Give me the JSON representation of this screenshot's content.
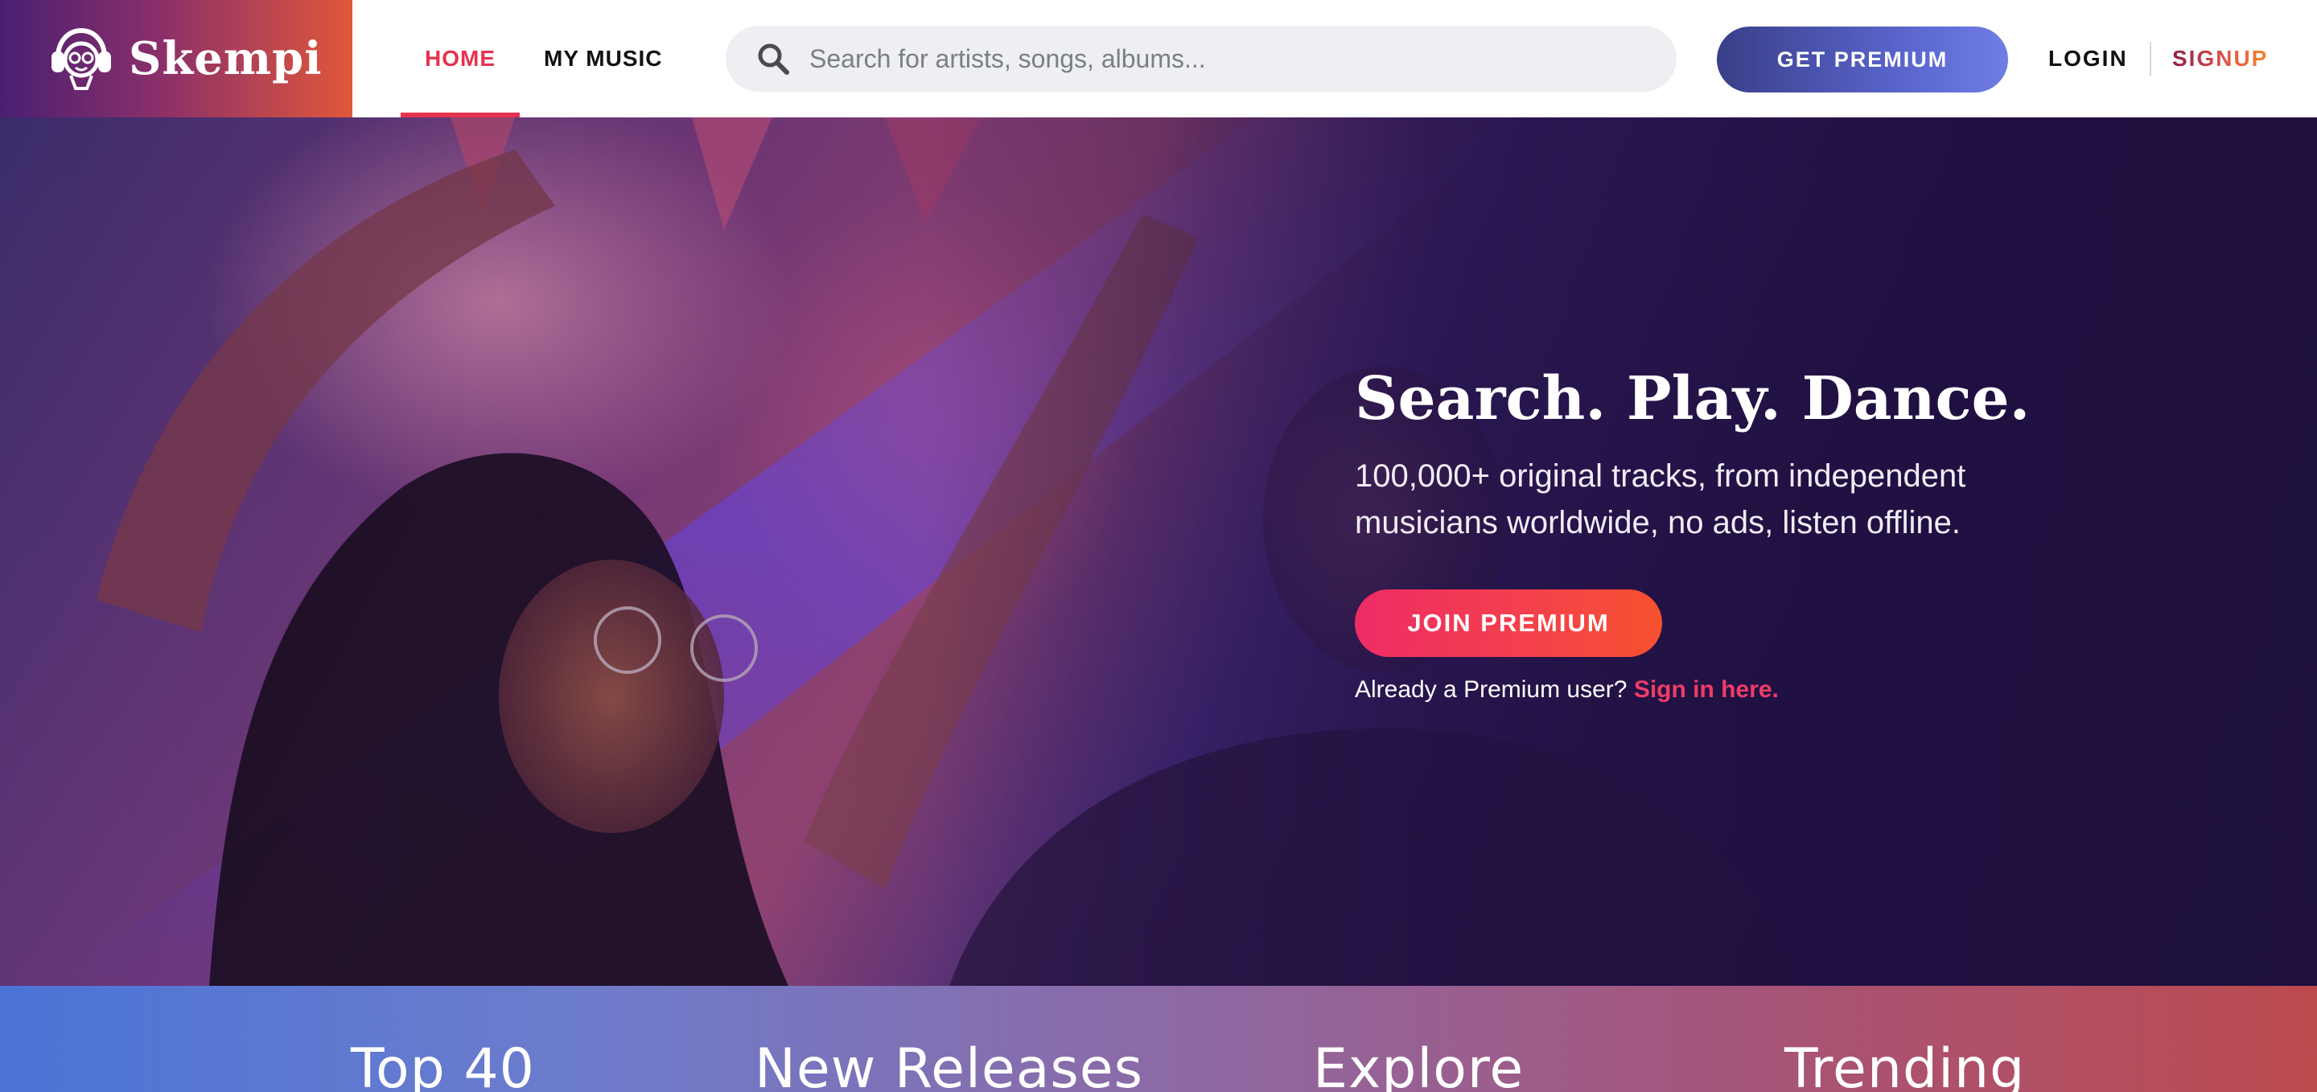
{
  "brand": {
    "name": "Skempi",
    "icon": "headphones-mascot-icon"
  },
  "nav": {
    "items": [
      {
        "label": "HOME",
        "active": true
      },
      {
        "label": "MY MUSIC",
        "active": false
      }
    ]
  },
  "search": {
    "placeholder": "Search for artists, songs, albums...",
    "value": "",
    "icon": "search-icon"
  },
  "header_actions": {
    "get_premium": "GET PREMIUM",
    "login": "LOGIN",
    "signup": "SIGNUP"
  },
  "hero": {
    "title": "Search. Play. Dance.",
    "subtitle": "100,000+ original tracks, from independent musicians worldwide, no ads, listen offline.",
    "cta": "JOIN PREMIUM",
    "signin_prompt": "Already a Premium user?",
    "signin_link": "Sign in here."
  },
  "categories": [
    "Top 40",
    "New Releases",
    "Explore",
    "Trending"
  ],
  "colors": {
    "accent": "#e4334f",
    "cta_start": "#ee2c66",
    "cta_end": "#f6512f",
    "premium_button_start": "#3a3f88",
    "premium_button_end": "#6f7de6",
    "hero_dark": "#1e1140"
  }
}
